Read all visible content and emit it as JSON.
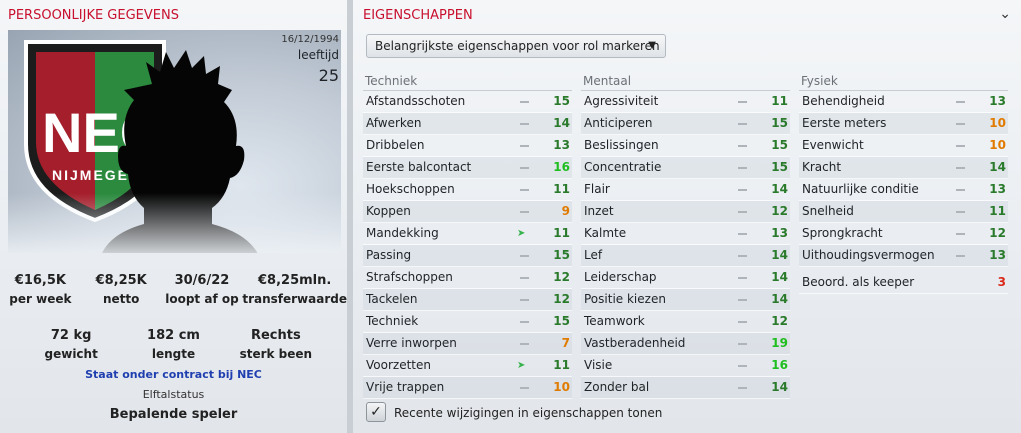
{
  "left": {
    "title": "PERSOONLIJKE GEGEVENS",
    "club_crest_text": "NEC",
    "club_crest_word": "NIJMEGEN",
    "dob": "16/12/1994",
    "age_label": "leeftijd",
    "age": "25",
    "stats_row1": [
      {
        "value": "€16,5K",
        "label": "per week"
      },
      {
        "value": "€8,25K",
        "label": "netto"
      },
      {
        "value": "30/6/22",
        "label": "loopt af op"
      },
      {
        "value": "€8,25mln.",
        "label": "transferwaarde"
      }
    ],
    "stats_row2": [
      {
        "value": "72 kg",
        "label": "gewicht"
      },
      {
        "value": "182 cm",
        "label": "lengte"
      },
      {
        "value": "Rechts",
        "label": "sterk been"
      }
    ],
    "contract": "Staat onder contract bij NEC",
    "status_label": "Elftalstatus",
    "status_value": "Bepalende speler"
  },
  "right": {
    "title": "EIGENSCHAPPEN",
    "collapse_icon": "chevron-down-icon",
    "dropdown": "Belangrijkste eigenschappen voor rol markeren",
    "columns": [
      {
        "header": "Techniek",
        "rows": [
          {
            "name": "Afstandsschoten",
            "value": "15",
            "trend": "dash"
          },
          {
            "name": "Afwerken",
            "value": "14",
            "trend": "dash"
          },
          {
            "name": "Dribbelen",
            "value": "13",
            "trend": "dash"
          },
          {
            "name": "Eerste balcontact",
            "value": "16",
            "trend": "dash"
          },
          {
            "name": "Hoekschoppen",
            "value": "11",
            "trend": "dash"
          },
          {
            "name": "Koppen",
            "value": "9",
            "trend": "dash"
          },
          {
            "name": "Mandekking",
            "value": "11",
            "trend": "up"
          },
          {
            "name": "Passing",
            "value": "15",
            "trend": "dash"
          },
          {
            "name": "Strafschoppen",
            "value": "12",
            "trend": "dash"
          },
          {
            "name": "Tackelen",
            "value": "12",
            "trend": "dash"
          },
          {
            "name": "Techniek",
            "value": "15",
            "trend": "dash"
          },
          {
            "name": "Verre inworpen",
            "value": "7",
            "trend": "dash"
          },
          {
            "name": "Voorzetten",
            "value": "11",
            "trend": "up"
          },
          {
            "name": "Vrije trappen",
            "value": "10",
            "trend": "dash"
          }
        ]
      },
      {
        "header": "Mentaal",
        "rows": [
          {
            "name": "Agressiviteit",
            "value": "11",
            "trend": "dash"
          },
          {
            "name": "Anticiperen",
            "value": "15",
            "trend": "dash"
          },
          {
            "name": "Beslissingen",
            "value": "15",
            "trend": "dash"
          },
          {
            "name": "Concentratie",
            "value": "15",
            "trend": "dash"
          },
          {
            "name": "Flair",
            "value": "14",
            "trend": "dash"
          },
          {
            "name": "Inzet",
            "value": "12",
            "trend": "dash"
          },
          {
            "name": "Kalmte",
            "value": "13",
            "trend": "dash"
          },
          {
            "name": "Lef",
            "value": "14",
            "trend": "dash"
          },
          {
            "name": "Leiderschap",
            "value": "14",
            "trend": "dash"
          },
          {
            "name": "Positie kiezen",
            "value": "14",
            "trend": "dash"
          },
          {
            "name": "Teamwork",
            "value": "12",
            "trend": "dash"
          },
          {
            "name": "Vastberadenheid",
            "value": "19",
            "trend": "dash"
          },
          {
            "name": "Visie",
            "value": "16",
            "trend": "dash"
          },
          {
            "name": "Zonder bal",
            "value": "14",
            "trend": "dash"
          }
        ]
      },
      {
        "header": "Fysiek",
        "rows": [
          {
            "name": "Behendigheid",
            "value": "13",
            "trend": "dash"
          },
          {
            "name": "Eerste meters",
            "value": "10",
            "trend": "dash"
          },
          {
            "name": "Evenwicht",
            "value": "10",
            "trend": "dash"
          },
          {
            "name": "Kracht",
            "value": "14",
            "trend": "dash"
          },
          {
            "name": "Natuurlijke conditie",
            "value": "13",
            "trend": "dash"
          },
          {
            "name": "Snelheid",
            "value": "11",
            "trend": "dash"
          },
          {
            "name": "Sprongkracht",
            "value": "12",
            "trend": "dash"
          },
          {
            "name": "Uithoudingsvermogen",
            "value": "13",
            "trend": "dash"
          }
        ],
        "keeper": {
          "name": "Beoord. als keeper",
          "value": "3"
        }
      }
    ],
    "checkbox_label": "Recente wijzigingen in eigenschappen tonen",
    "checkbox_checked": true
  }
}
